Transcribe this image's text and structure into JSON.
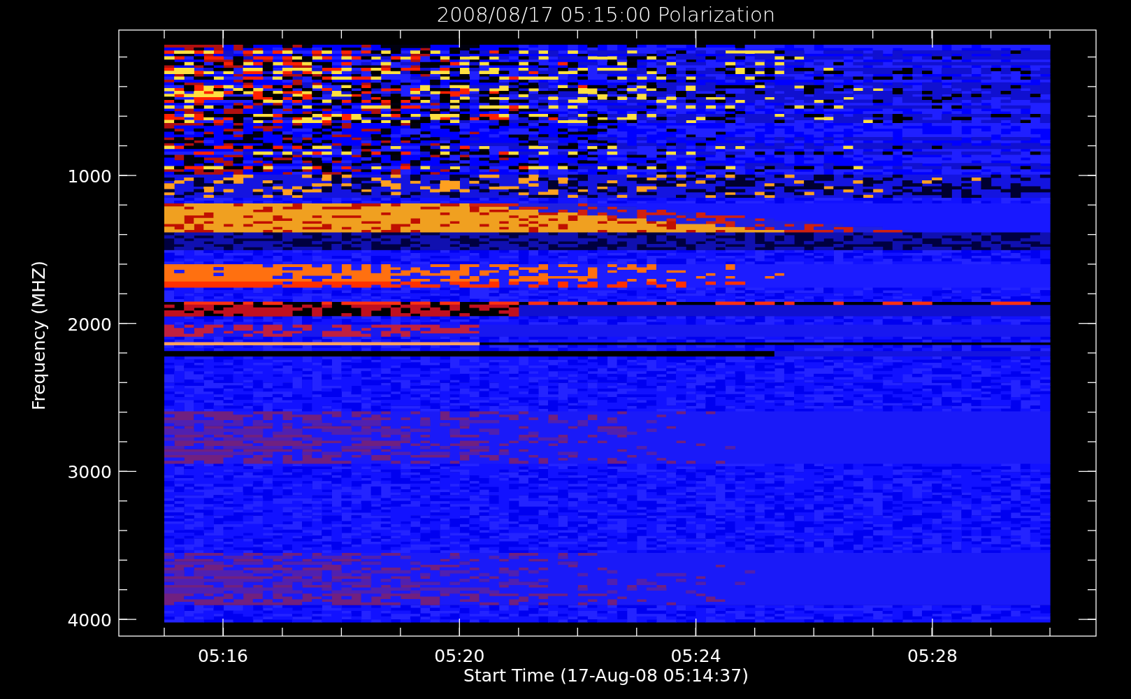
{
  "title": "2008/08/17 05:15:00 Polarization",
  "y_axis": {
    "label": "Frequency (MHZ)",
    "ticks": [
      "1000",
      "2000",
      "3000",
      "4000"
    ]
  },
  "x_axis": {
    "label": "Start Time (17-Aug-08 05:14:37)",
    "ticks": [
      "05:16",
      "05:20",
      "05:24",
      "05:28"
    ]
  }
}
